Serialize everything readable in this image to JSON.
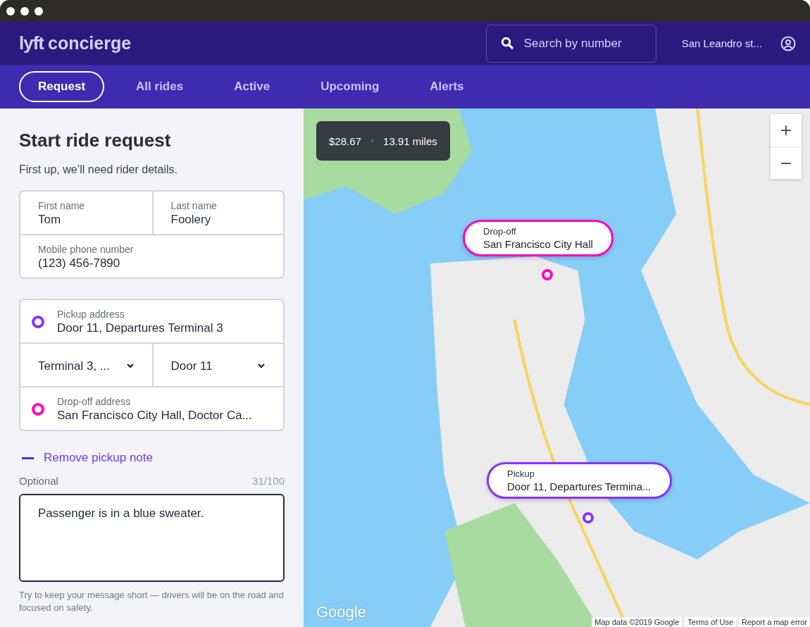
{
  "header": {
    "logo": "lyft",
    "product": "concierge",
    "search": {
      "placeholder": "Search by number"
    },
    "account": "San Leandro st..."
  },
  "tabs": [
    {
      "label": "Request",
      "selected": true
    },
    {
      "label": "All rides",
      "selected": false
    },
    {
      "label": "Active",
      "selected": false
    },
    {
      "label": "Upcoming",
      "selected": false
    },
    {
      "label": "Alerts",
      "selected": false
    }
  ],
  "form": {
    "title": "Start ride request",
    "subtitle": "First up, we’ll need rider details.",
    "rider_fields": [
      {
        "label": "First name",
        "value": "Tom"
      },
      {
        "label": "Last name",
        "value": "Foolery"
      },
      {
        "label": "Mobile phone number",
        "value": "(123) 456-7890"
      }
    ],
    "pickup": {
      "label": "Pickup address",
      "value": "Door 11, Departures Terminal 3",
      "color": "#8833ff"
    },
    "pickup_options": [
      {
        "value": "Terminal 3, ..."
      },
      {
        "value": "Door 11"
      }
    ],
    "dropoff": {
      "label": "Drop-off address",
      "value": "San Francisco City Hall, Doctor Ca...",
      "color": "#ff00bf"
    },
    "note": {
      "toggle": "Remove pickup note",
      "label": "Optional",
      "counter": "31/100",
      "value": "Passenger is in a blue sweater.",
      "hint": "Try to keep your message short — drivers will be on the road and focused on safety."
    }
  },
  "map": {
    "fare": "$28.67",
    "separator": "•",
    "distance": "13.91 miles",
    "zoom": [
      "+",
      "−"
    ],
    "markers": [
      {
        "kind": "dropoff",
        "label": "Drop-off",
        "value": "San Francisco City Hall",
        "color": "#ff00bf"
      },
      {
        "kind": "pickup",
        "label": "Pickup",
        "value": "Door 11, Departures Termina...",
        "color": "#8833ff"
      }
    ],
    "logo": "Google",
    "attribution": [
      "Map data ©2019 Google",
      "Terms of Use",
      "Report a map error"
    ]
  }
}
